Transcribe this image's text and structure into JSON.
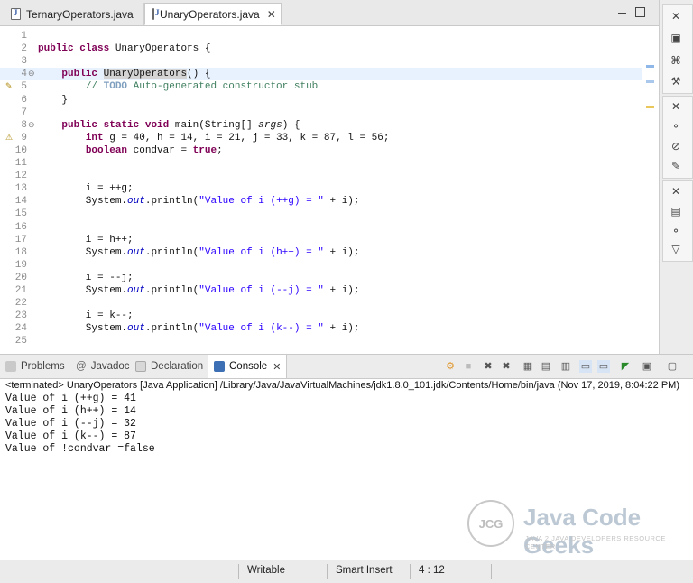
{
  "editor": {
    "tabs": [
      {
        "label": "TernaryOperators.java",
        "active": false
      },
      {
        "label": "UnaryOperators.java",
        "active": true
      }
    ],
    "lines": [
      {
        "n": "1",
        "text": ""
      },
      {
        "n": "2",
        "text": "public class UnaryOperators {"
      },
      {
        "n": "3",
        "text": ""
      },
      {
        "n": "4⊖",
        "text": "    public UnaryOperators() {"
      },
      {
        "n": "5",
        "text": "        // TODO Auto-generated constructor stub"
      },
      {
        "n": "6",
        "text": "    }"
      },
      {
        "n": "7",
        "text": ""
      },
      {
        "n": "8⊖",
        "text": "    public static void main(String[] args) {"
      },
      {
        "n": "9",
        "text": "        int g = 40, h = 14, i = 21, j = 33, k = 87, l = 56;"
      },
      {
        "n": "10",
        "text": "        boolean condvar = true;"
      },
      {
        "n": "11",
        "text": ""
      },
      {
        "n": "12",
        "text": ""
      },
      {
        "n": "13",
        "text": "        i = ++g;"
      },
      {
        "n": "14",
        "text": "        System.out.println(\"Value of i (++g) = \" + i);"
      },
      {
        "n": "15",
        "text": ""
      },
      {
        "n": "16",
        "text": ""
      },
      {
        "n": "17",
        "text": "        i = h++;"
      },
      {
        "n": "18",
        "text": "        System.out.println(\"Value of i (h++) = \" + i);"
      },
      {
        "n": "19",
        "text": ""
      },
      {
        "n": "20",
        "text": "        i = --j;"
      },
      {
        "n": "21",
        "text": "        System.out.println(\"Value of i (--j) = \" + i);"
      },
      {
        "n": "22",
        "text": ""
      },
      {
        "n": "23",
        "text": "        i = k--;"
      },
      {
        "n": "24",
        "text": "        System.out.println(\"Value of i (k--) = \" + i);"
      },
      {
        "n": "25",
        "text": ""
      }
    ],
    "highlighted_line": "4",
    "colors": {
      "keyword": "#7f0055",
      "comment": "#3f7f5f",
      "string": "#2a00ff",
      "field": "#0000c0",
      "line_highlight": "#e8f2fe"
    }
  },
  "console": {
    "tabs": [
      {
        "label": "Problems",
        "icon": "problems-icon"
      },
      {
        "label": "Javadoc",
        "icon": "at-icon"
      },
      {
        "label": "Declaration",
        "icon": "declaration-icon"
      },
      {
        "label": "Console",
        "icon": "console-icon",
        "active": true
      }
    ],
    "terminated": "<terminated> UnaryOperators [Java Application] /Library/Java/JavaVirtualMachines/jdk1.8.0_101.jdk/Contents/Home/bin/java (Nov 17, 2019, 8:04:22 PM)",
    "output": [
      "Value of i (++g) = 41",
      "Value of i (h++) = 14",
      "Value of i (--j) = 32",
      "Value of i (k--) = 87",
      "Value of !condvar =false"
    ]
  },
  "watermark": {
    "badge": "JCG",
    "title": "Java Code Geeks",
    "subtitle": "JAVA 2 JAVA DEVELOPERS RESOURCE CENTER"
  },
  "status": {
    "writable": "Writable",
    "insert_mode": "Smart Insert",
    "position": "4 : 12"
  }
}
